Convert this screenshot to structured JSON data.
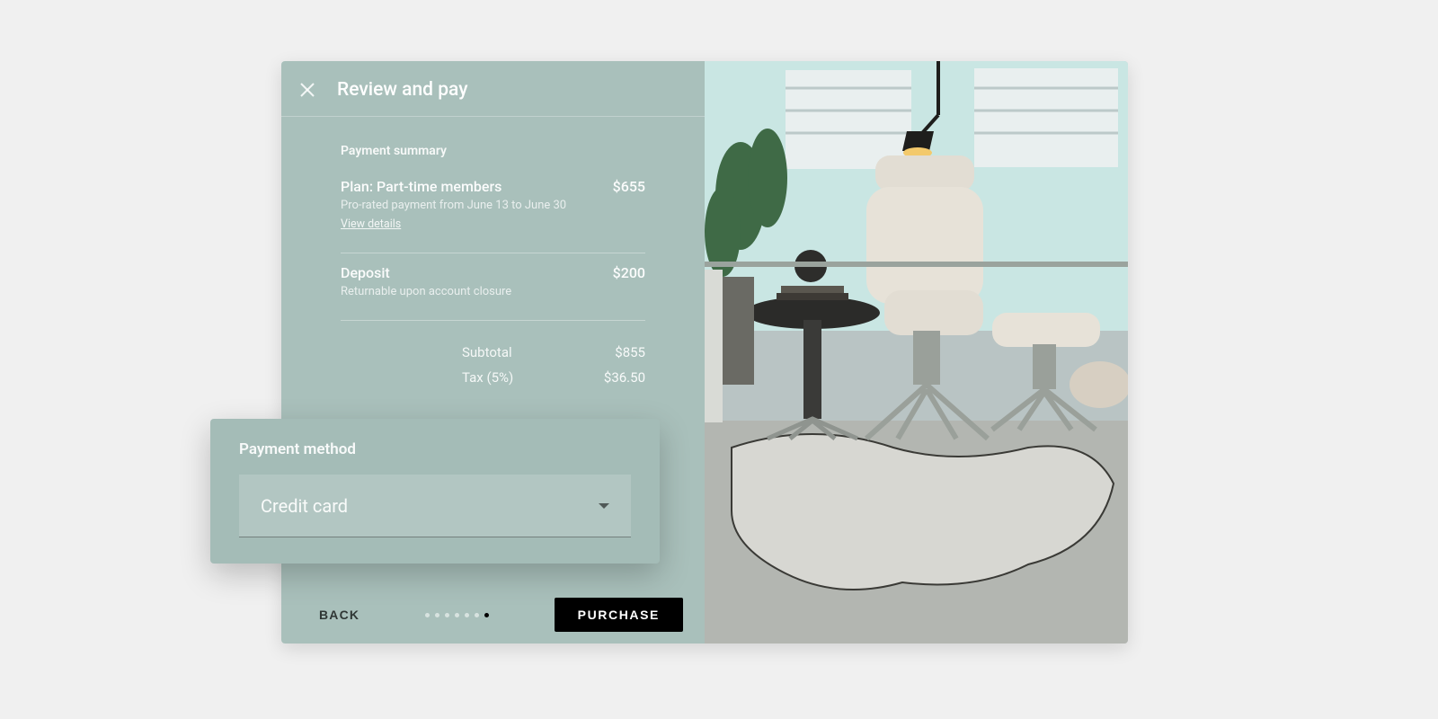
{
  "header": {
    "title": "Review and pay"
  },
  "summary": {
    "section_label": "Payment summary",
    "plan": {
      "label": "Plan: Part-time members",
      "sub": "Pro-rated payment from June 13 to June 30",
      "amount": "$655",
      "view_details": "View details"
    },
    "deposit": {
      "label": "Deposit",
      "sub": "Returnable upon account closure",
      "amount": "$200"
    },
    "subtotal": {
      "label": "Subtotal",
      "amount": "$855"
    },
    "tax": {
      "label": "Tax (5%)",
      "amount": "$36.50"
    }
  },
  "payment_method": {
    "title": "Payment method",
    "selected": "Credit card"
  },
  "footer": {
    "back": "BACK",
    "purchase": "PURCHASE",
    "progress": {
      "total": 7,
      "current": 7
    }
  }
}
